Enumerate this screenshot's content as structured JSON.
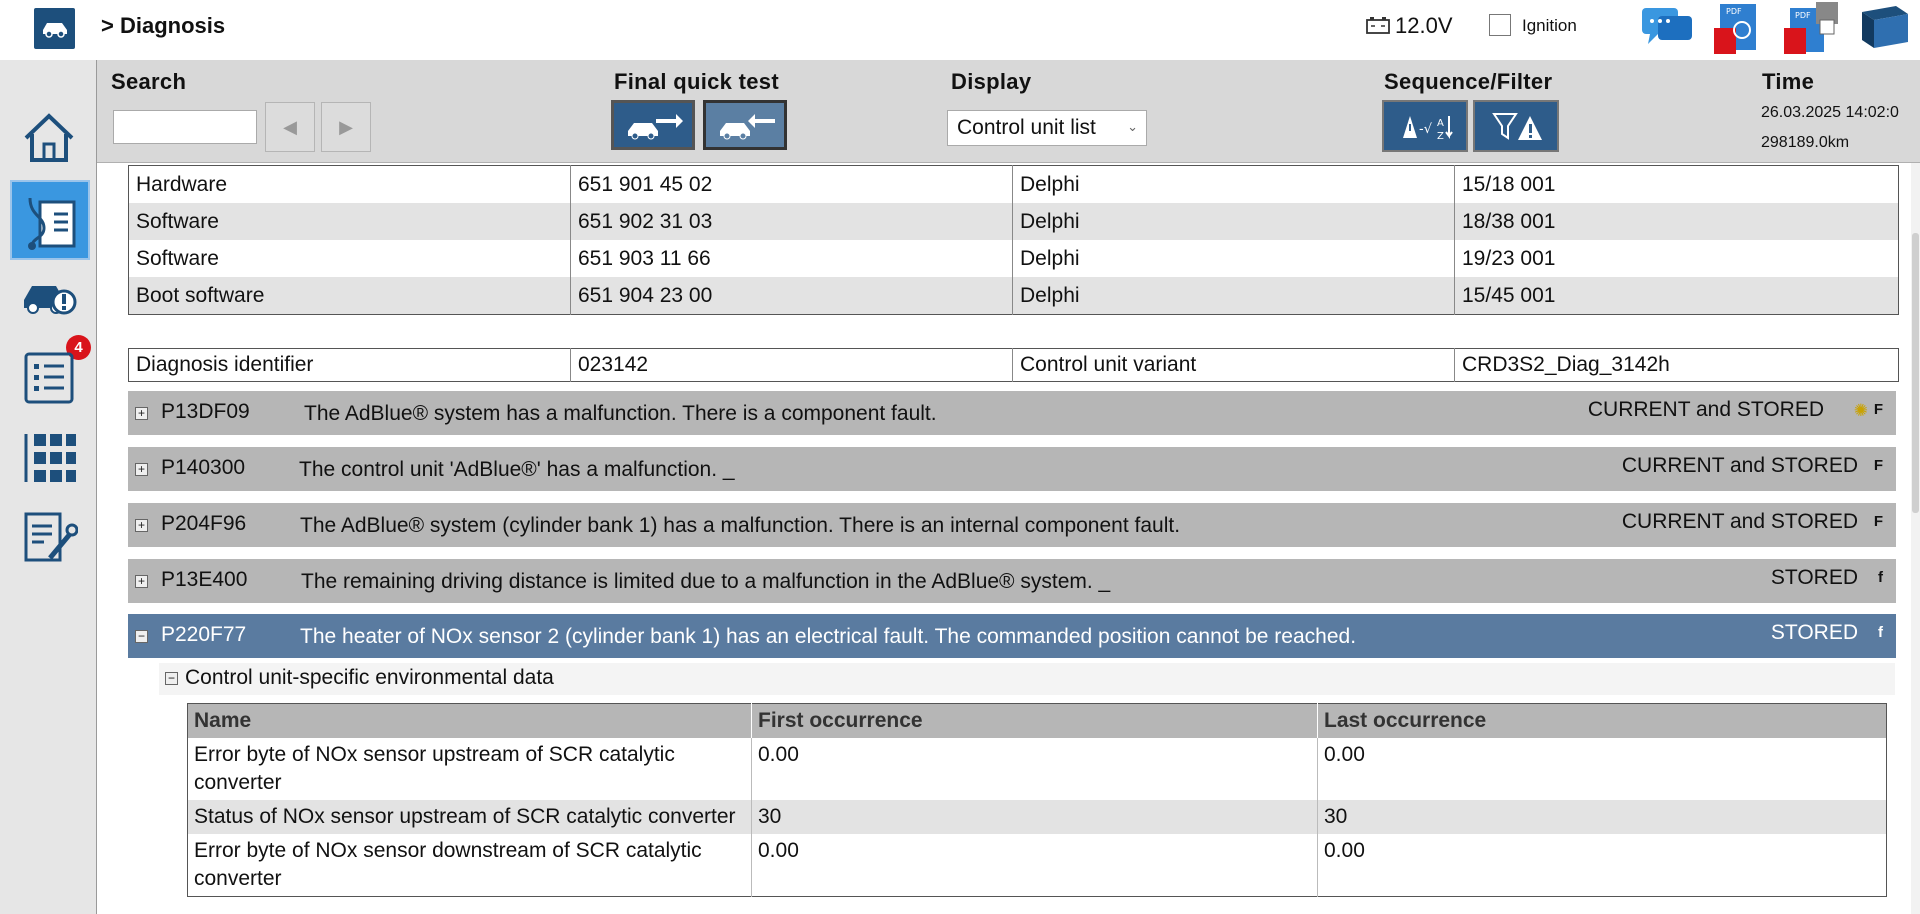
{
  "header": {
    "title": "> Diagnosis",
    "voltage": "12.0V",
    "ignition_label": "Ignition"
  },
  "sidebar": {
    "items": [
      {
        "icon": "home-icon"
      },
      {
        "icon": "diagnosis-icon",
        "active": true
      },
      {
        "icon": "vehicle-warning-icon",
        "badge": "4"
      },
      {
        "icon": "list-icon"
      },
      {
        "icon": "control-units-icon"
      },
      {
        "icon": "service-tools-icon"
      }
    ]
  },
  "toolbar": {
    "search_label": "Search",
    "search_value": "",
    "final_quick_test_label": "Final quick test",
    "display_label": "Display",
    "display_selected": "Control unit list",
    "sequence_filter_label": "Sequence/Filter",
    "time_label": "Time",
    "time_value": "26.03.2025 14:02:0",
    "mileage": "298189.0km"
  },
  "software_table": [
    {
      "type": "Hardware",
      "number": "651 901 45 02",
      "supplier": "Delphi",
      "version": "15/18 001"
    },
    {
      "type": "Software",
      "number": "651 902 31 03",
      "supplier": "Delphi",
      "version": "18/38 001"
    },
    {
      "type": "Software",
      "number": "651 903 11 66",
      "supplier": "Delphi",
      "version": "19/23 001"
    },
    {
      "type": "Boot software",
      "number": "651 904 23 00",
      "supplier": "Delphi",
      "version": "15/45 001"
    }
  ],
  "diag_info": {
    "identifier_label": "Diagnosis identifier",
    "identifier_value": "023142",
    "variant_label": "Control unit variant",
    "variant_value": "CRD3S2_Diag_3142h"
  },
  "faults": [
    {
      "code": "P13DF09",
      "text": "The AdBlue® system has a malfunction. There is a component fault.",
      "status": "CURRENT and STORED",
      "flag": "F",
      "warning_light": true
    },
    {
      "code": "P140300",
      "text": "The control unit 'AdBlue®' has a malfunction. _",
      "status": "CURRENT and STORED",
      "flag": "F"
    },
    {
      "code": "P204F96",
      "text": "The AdBlue® system (cylinder bank 1) has a malfunction. There is an internal component fault.",
      "status": "CURRENT and STORED",
      "flag": "F"
    },
    {
      "code": "P13E400",
      "text": "The remaining driving distance is limited due to a malfunction in the AdBlue® system. _",
      "status": "STORED",
      "flag": "f"
    },
    {
      "code": "P220F77",
      "text": "The heater of NOx sensor 2 (cylinder bank 1) has an electrical fault. The commanded position cannot be reached.",
      "status": "STORED",
      "flag": "f",
      "expanded": true
    }
  ],
  "environment": {
    "header": "Control unit-specific environmental data",
    "columns": [
      "Name",
      "First occurrence",
      "Last occurrence"
    ],
    "rows": [
      {
        "name": "Error byte of NOx sensor upstream of SCR catalytic converter",
        "first": "0.00",
        "last": "0.00"
      },
      {
        "name": "Status of NOx sensor upstream of SCR catalytic converter",
        "first": "30",
        "last": "30"
      },
      {
        "name": "Error byte of NOx sensor downstream of SCR catalytic converter",
        "first": "0.00",
        "last": "0.00"
      }
    ]
  },
  "colors": {
    "accent_blue": "#3a97e0",
    "selected_row": "#5a7ba0",
    "fault_row": "#b6b6b6",
    "badge_red": "#d9141b"
  }
}
